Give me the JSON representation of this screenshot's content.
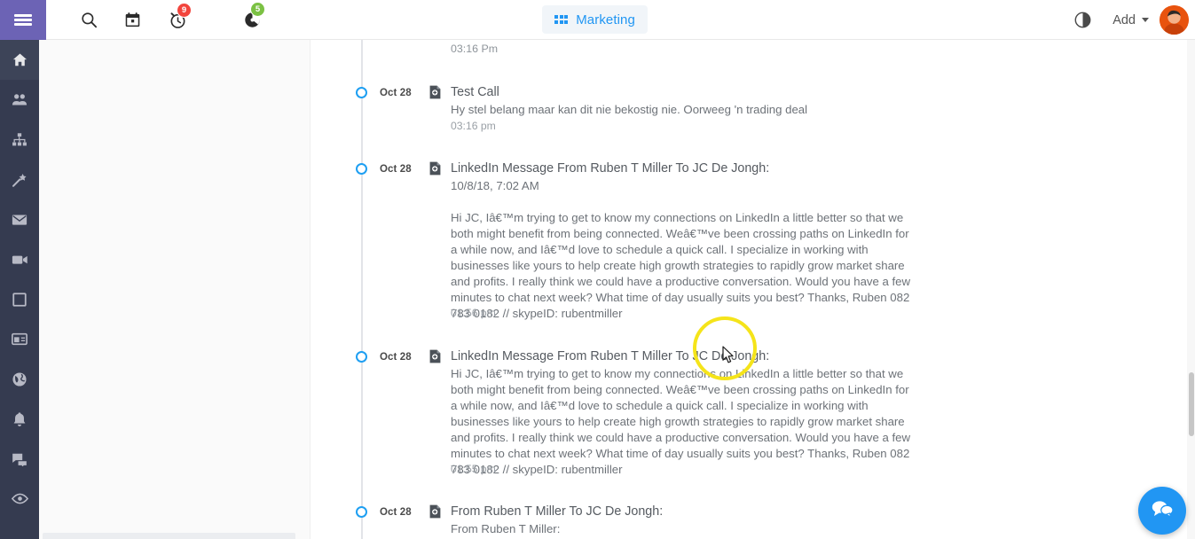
{
  "topbar": {
    "hamburger": "menu-toggle",
    "icons": [
      {
        "name": "search-icon"
      },
      {
        "name": "calendar-icon"
      },
      {
        "name": "alarm-icon",
        "badge": "9",
        "badge_color": "#f2453d"
      },
      {
        "name": "pie-chart-icon",
        "badge": "5",
        "badge_color": "#7bc143"
      }
    ],
    "tab": {
      "label": "Marketing",
      "color": "#2196f3"
    },
    "half_moon": "half-moon-icon",
    "add_label": "Add",
    "avatar": "user-avatar"
  },
  "sidebar": {
    "background": "#353b50",
    "items": [
      {
        "name": "home",
        "icon": "home-icon",
        "active": true
      },
      {
        "name": "contacts",
        "icon": "people-icon",
        "active": false
      },
      {
        "name": "organization",
        "icon": "sitemap-icon",
        "active": false
      },
      {
        "name": "campaigns",
        "icon": "magic-wand-icon",
        "active": false
      },
      {
        "name": "mail",
        "icon": "envelope-icon",
        "active": false
      },
      {
        "name": "video",
        "icon": "video-camera-icon",
        "active": false
      },
      {
        "name": "window",
        "icon": "square-icon",
        "active": false
      },
      {
        "name": "layout",
        "icon": "panel-icon",
        "active": false
      },
      {
        "name": "globe",
        "icon": "globe-icon",
        "active": false
      },
      {
        "name": "notifications",
        "icon": "bell-icon",
        "active": false
      },
      {
        "name": "chat",
        "icon": "comments-icon",
        "active": false
      },
      {
        "name": "views",
        "icon": "eye-icon",
        "active": false
      }
    ]
  },
  "timeline": {
    "accent": "#1e9ff2",
    "orphan_time": "03:16 Pm",
    "entries": [
      {
        "date": "Oct 28",
        "title": "Test Call",
        "subtitle": "Hy stel belang maar kan dit nie bekostig nie. Oorweeg 'n trading deal",
        "time": "03:16 pm"
      },
      {
        "date": "Oct 28",
        "title": "LinkedIn Message From Ruben T Miller To JC De Jongh:",
        "subtitle": "10/8/18, 7:02 AM",
        "body": "Hi JC, Iâ€™m trying to get to know my connections on LinkedIn a little better so that we both might benefit from being connected. Weâ€™ve been crossing paths on LinkedIn for a while now, and Iâ€™d love to schedule a quick call. I specialize in working with businesses like yours to help create high growth strategies to rapidly grow market share and profits. I really think we could have a productive conversation. Would you have a few minutes to chat next week? What time of day usually suits you best? Thanks, Ruben 082 783 0182 // skypeID: rubentmiller",
        "time": "01:56 pm"
      },
      {
        "date": "Oct 28",
        "title": "LinkedIn Message From Ruben T Miller To JC De Jongh:",
        "body": "Hi JC, Iâ€™m trying to get to know my connections on LinkedIn a little better so that we both might benefit from being connected. Weâ€™ve been crossing paths on LinkedIn for a while now, and Iâ€™d love to schedule a quick call. I specialize in working with businesses like yours to help create high growth strategies to rapidly grow market share and profits. I really think we could have a productive conversation. Would you have a few minutes to chat next week? What time of day usually suits you best? Thanks, Ruben 082 783 0182 // skypeID: rubentmiller",
        "time": "01:55 pm"
      },
      {
        "date": "Oct 28",
        "title": "From Ruben T Miller To JC De Jongh:",
        "subtitle": "From Ruben T Miller:"
      }
    ]
  },
  "chat_fab": {
    "name": "chat-bubble-icon",
    "color": "#2196f3"
  },
  "scrollbar": {
    "name": "vertical-scrollbar"
  }
}
